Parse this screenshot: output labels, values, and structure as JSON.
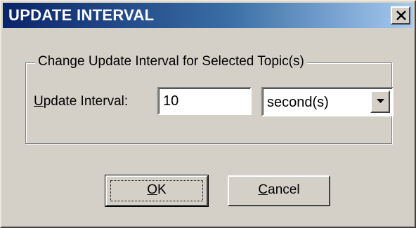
{
  "window": {
    "title": "UPDATE INTERVAL",
    "close_glyph": "×"
  },
  "group": {
    "legend": "Change Update Interval for Selected Topic(s)"
  },
  "interval": {
    "label_accel": "U",
    "label_rest": "pdate Interval:",
    "value": "10"
  },
  "unit": {
    "selected": "second(s)",
    "icon": "chevron-down-icon"
  },
  "buttons": {
    "ok_accel": "O",
    "ok_rest": "K",
    "cancel_accel": "C",
    "cancel_rest": "ancel"
  },
  "colors": {
    "title_gradient_start": "#0a246a",
    "title_gradient_end": "#a6caf0",
    "dialog_face": "#d4d0c8"
  }
}
